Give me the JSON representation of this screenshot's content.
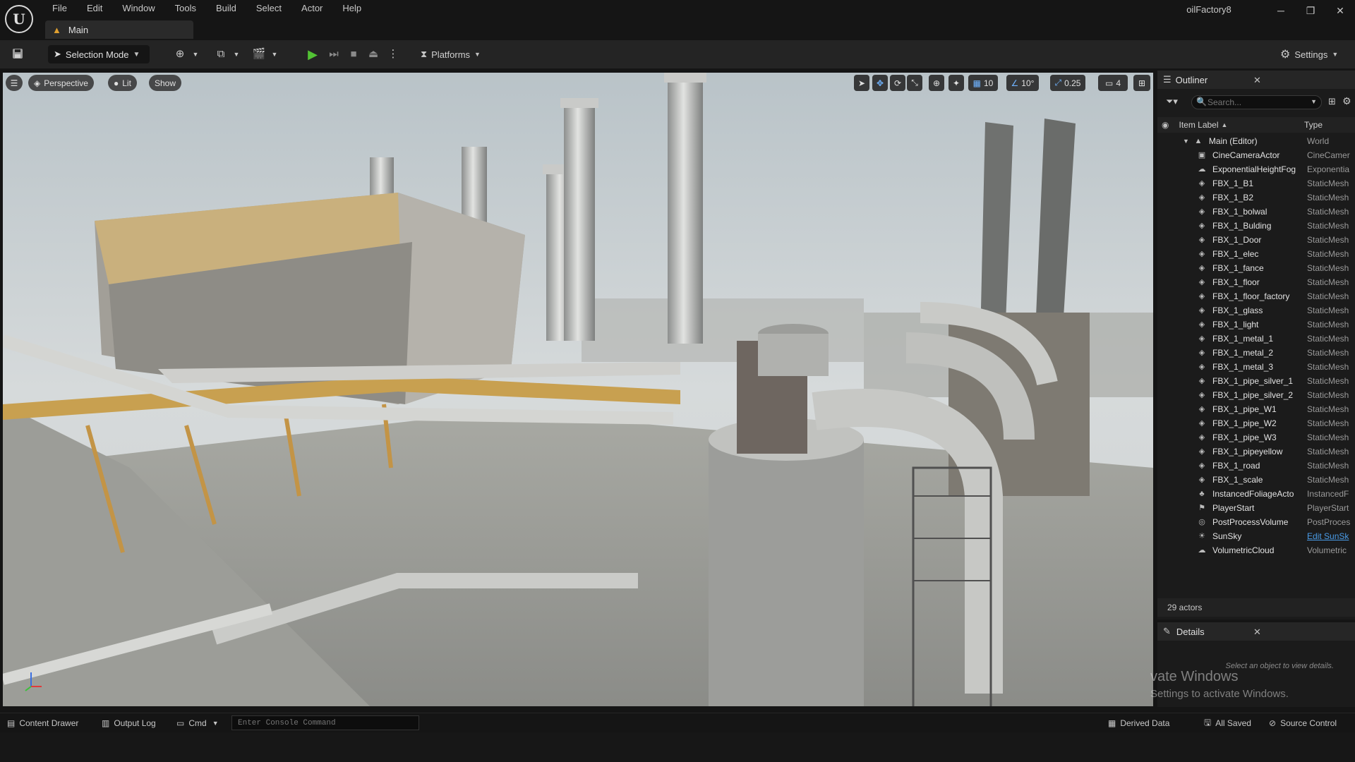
{
  "app": {
    "project_name": "oilFactory8",
    "menu": [
      "File",
      "Edit",
      "Window",
      "Tools",
      "Build",
      "Select",
      "Actor",
      "Help"
    ],
    "document_tab": "Main",
    "window_buttons": {
      "minimize": "─",
      "restore": "❐",
      "close": "✕"
    }
  },
  "toolbar": {
    "selection_mode": "Selection Mode",
    "platforms": "Platforms",
    "settings": "Settings"
  },
  "viewport": {
    "perspective": "Perspective",
    "lit": "Lit",
    "show": "Show",
    "grid_snap": "10",
    "rotation_snap": "10°",
    "scale_snap": "0.25",
    "camera_speed": "4"
  },
  "outliner": {
    "title": "Outliner",
    "search_placeholder": "Search...",
    "col_label": "Item Label",
    "col_type": "Type",
    "root": {
      "name": "Main (Editor)",
      "type": "World"
    },
    "items": [
      {
        "name": "CineCameraActor",
        "type": "CineCamer",
        "icon": "camera-icon"
      },
      {
        "name": "ExponentialHeightFog",
        "type": "Exponentia",
        "icon": "fog-icon"
      },
      {
        "name": "FBX_1_B1",
        "type": "StaticMesh",
        "icon": "mesh-icon"
      },
      {
        "name": "FBX_1_B2",
        "type": "StaticMesh",
        "icon": "mesh-icon"
      },
      {
        "name": "FBX_1_bolwal",
        "type": "StaticMesh",
        "icon": "mesh-icon"
      },
      {
        "name": "FBX_1_Bulding",
        "type": "StaticMesh",
        "icon": "mesh-icon"
      },
      {
        "name": "FBX_1_Door",
        "type": "StaticMesh",
        "icon": "mesh-icon"
      },
      {
        "name": "FBX_1_elec",
        "type": "StaticMesh",
        "icon": "mesh-icon"
      },
      {
        "name": "FBX_1_fance",
        "type": "StaticMesh",
        "icon": "mesh-icon"
      },
      {
        "name": "FBX_1_floor",
        "type": "StaticMesh",
        "icon": "mesh-icon"
      },
      {
        "name": "FBX_1_floor_factory",
        "type": "StaticMesh",
        "icon": "mesh-icon"
      },
      {
        "name": "FBX_1_glass",
        "type": "StaticMesh",
        "icon": "mesh-icon"
      },
      {
        "name": "FBX_1_light",
        "type": "StaticMesh",
        "icon": "mesh-icon"
      },
      {
        "name": "FBX_1_metal_1",
        "type": "StaticMesh",
        "icon": "mesh-icon"
      },
      {
        "name": "FBX_1_metal_2",
        "type": "StaticMesh",
        "icon": "mesh-icon"
      },
      {
        "name": "FBX_1_metal_3",
        "type": "StaticMesh",
        "icon": "mesh-icon"
      },
      {
        "name": "FBX_1_pipe_silver_1",
        "type": "StaticMesh",
        "icon": "mesh-icon"
      },
      {
        "name": "FBX_1_pipe_silver_2",
        "type": "StaticMesh",
        "icon": "mesh-icon"
      },
      {
        "name": "FBX_1_pipe_W1",
        "type": "StaticMesh",
        "icon": "mesh-icon"
      },
      {
        "name": "FBX_1_pipe_W2",
        "type": "StaticMesh",
        "icon": "mesh-icon"
      },
      {
        "name": "FBX_1_pipe_W3",
        "type": "StaticMesh",
        "icon": "mesh-icon"
      },
      {
        "name": "FBX_1_pipeyellow",
        "type": "StaticMesh",
        "icon": "mesh-icon"
      },
      {
        "name": "FBX_1_road",
        "type": "StaticMesh",
        "icon": "mesh-icon"
      },
      {
        "name": "FBX_1_scale",
        "type": "StaticMesh",
        "icon": "mesh-icon"
      },
      {
        "name": "InstancedFoliageActo",
        "type": "InstancedF",
        "icon": "foliage-icon"
      },
      {
        "name": "PlayerStart",
        "type": "PlayerStart",
        "icon": "flag-icon"
      },
      {
        "name": "PostProcessVolume",
        "type": "PostProces",
        "icon": "volume-icon"
      },
      {
        "name": "SunSky",
        "type": "Edit SunSk",
        "icon": "sun-icon"
      },
      {
        "name": "VolumetricCloud",
        "type": "Volumetric",
        "icon": "cloud-icon"
      }
    ],
    "actor_count": "29 actors"
  },
  "details": {
    "title": "Details",
    "hint": "Select an object to view details."
  },
  "watermark": {
    "line1": "vate Windows",
    "line2": "Settings to activate Windows."
  },
  "statusbar": {
    "content_drawer": "Content Drawer",
    "output_log": "Output Log",
    "cmd": "Cmd",
    "console_placeholder": "Enter Console Command",
    "derived_data": "Derived Data",
    "all_saved": "All Saved",
    "source_control": "Source Control"
  }
}
